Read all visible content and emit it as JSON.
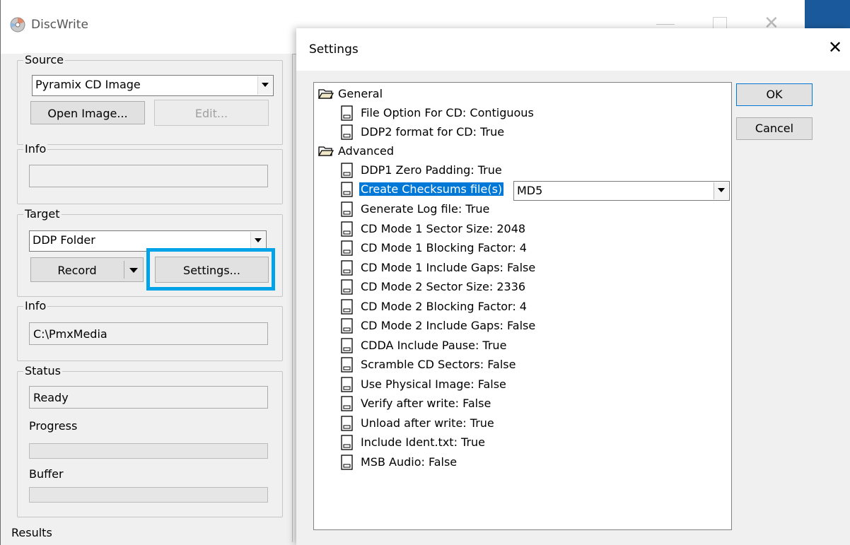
{
  "app": {
    "title": "DiscWrite"
  },
  "source": {
    "label": "Source",
    "combo_value": "Pyramix CD Image",
    "open_image_label": "Open Image...",
    "edit_label": "Edit..."
  },
  "info1": {
    "label": "Info",
    "value": ""
  },
  "target": {
    "label": "Target",
    "combo_value": "DDP Folder",
    "record_label": "Record",
    "settings_label": "Settings..."
  },
  "info2": {
    "label": "Info",
    "value": "C:\\PmxMedia"
  },
  "status": {
    "label": "Status",
    "value": "Ready",
    "progress_label": "Progress",
    "progress_value": 0,
    "buffer_label": "Buffer",
    "buffer_value": 0
  },
  "results_label": "Results",
  "settings_dialog": {
    "title": "Settings",
    "ok_label": "OK",
    "cancel_label": "Cancel",
    "tree": {
      "general": {
        "label": "General",
        "items": [
          "File Option For CD: Contiguous",
          "DDP2 format for CD: True"
        ]
      },
      "advanced": {
        "label": "Advanced",
        "items": [
          "DDP1 Zero Padding: True",
          "Create Checksums file(s)",
          "Generate Log file: True",
          "CD Mode 1 Sector Size: 2048",
          "CD Mode 1 Blocking Factor: 4",
          "CD Mode 1 Include Gaps: False",
          "CD Mode 2 Sector Size: 2336",
          "CD Mode 2 Blocking Factor: 4",
          "CD Mode 2 Include Gaps: False",
          "CDDA Include Pause: True",
          "Scramble CD Sectors: False",
          "Use Physical Image: False",
          "Verify after write: False",
          "Unload after write: True",
          "Include Ident.txt: True",
          "MSB Audio: False"
        ]
      }
    },
    "checksum_combo_value": "MD5"
  },
  "colors": {
    "selection": "#0078d7",
    "highlight_frame": "#00a2e8",
    "title_blue": "#1a5a9c"
  }
}
